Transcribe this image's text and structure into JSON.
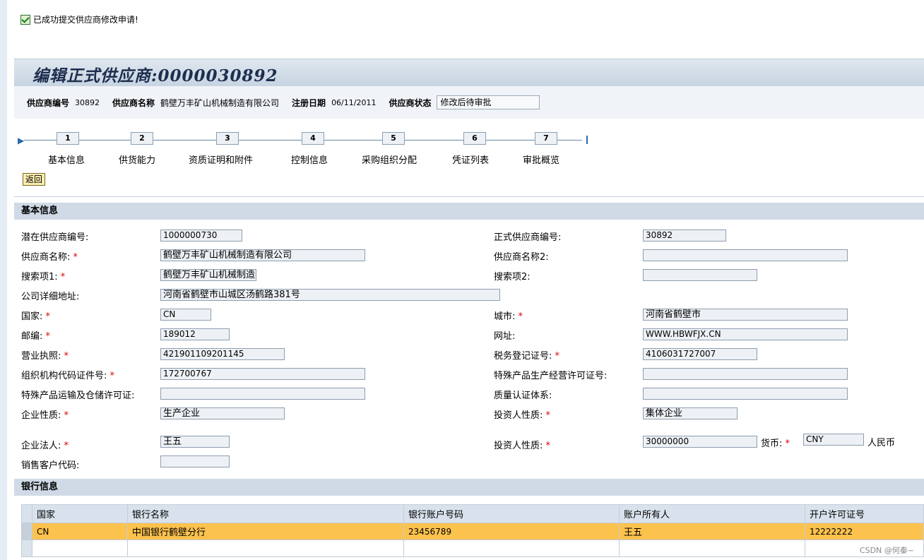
{
  "message": "已成功提交供应商修改申请!",
  "title": "编辑正式供应商:0000030892",
  "header": {
    "vendor_no_label": "供应商编号",
    "vendor_no": "30892",
    "vendor_name_label": "供应商名称",
    "vendor_name": "鹤壁万丰矿山机械制造有限公司",
    "reg_date_label": "注册日期",
    "reg_date": "06/11/2011",
    "status_label": "供应商状态",
    "status": "修改后待审批"
  },
  "roadmap": {
    "steps": [
      {
        "num": "1",
        "label": "基本信息"
      },
      {
        "num": "2",
        "label": "供货能力"
      },
      {
        "num": "3",
        "label": "资质证明和附件"
      },
      {
        "num": "4",
        "label": "控制信息"
      },
      {
        "num": "5",
        "label": "采购组织分配"
      },
      {
        "num": "6",
        "label": "凭证列表"
      },
      {
        "num": "7",
        "label": "审批概览"
      }
    ],
    "back_button": "返回"
  },
  "basic": {
    "section_title": "基本信息",
    "potential_no": {
      "label": "潜在供应商编号:",
      "value": "1000000730"
    },
    "formal_no": {
      "label": "正式供应商编号:",
      "value": "30892"
    },
    "name": {
      "label": "供应商名称:",
      "value": "鹤壁万丰矿山机械制造有限公司"
    },
    "name2": {
      "label": "供应商名称2:",
      "value": ""
    },
    "search1": {
      "label": "搜索项1:",
      "value": "鹤壁万丰矿山机械制造礻"
    },
    "search2": {
      "label": "搜索项2:",
      "value": ""
    },
    "address": {
      "label": "公司详细地址:",
      "value": "河南省鹤壁市山城区汤鹤路381号"
    },
    "country": {
      "label": "国家:",
      "value": "CN"
    },
    "city": {
      "label": "城市:",
      "value": "河南省鹤壁市"
    },
    "postcode": {
      "label": "邮编:",
      "value": "189012"
    },
    "website": {
      "label": "网址:",
      "value": "WWW.HBWFJX.CN"
    },
    "license": {
      "label": "营业执照:",
      "value": "421901109201145"
    },
    "tax_no": {
      "label": "税务登记证号:",
      "value": "4106031727007"
    },
    "org_code": {
      "label": "组织机构代码证件号:",
      "value": "172700767"
    },
    "special_prod_license": {
      "label": "特殊产品生产经营许可证号:",
      "value": ""
    },
    "special_transport": {
      "label": "特殊产品运输及仓储许可证:",
      "value": ""
    },
    "quality_cert": {
      "label": "质量认证体系:",
      "value": ""
    },
    "enterprise_type": {
      "label": "企业性质:",
      "value": "生产企业"
    },
    "investor_type": {
      "label": "投资人性质:",
      "value": "集体企业"
    },
    "legal_person": {
      "label": "企业法人:",
      "value": "王五"
    },
    "investor_type2": {
      "label": "投资人性质:",
      "value": "30000000"
    },
    "currency": {
      "label": "货币:",
      "value": "CNY",
      "text": "人民币"
    },
    "sales_customer": {
      "label": "销售客户代码:",
      "value": ""
    },
    "required_mark": "*"
  },
  "bank": {
    "section_title": "银行信息",
    "columns": [
      "国家",
      "银行名称",
      "银行账户号码",
      "账户所有人",
      "开户许可证号"
    ],
    "rows": [
      [
        "CN",
        "中国银行鹤壁分行",
        "23456789",
        "王五",
        "12222222"
      ]
    ]
  },
  "watermark": "CSDN @何秦~"
}
